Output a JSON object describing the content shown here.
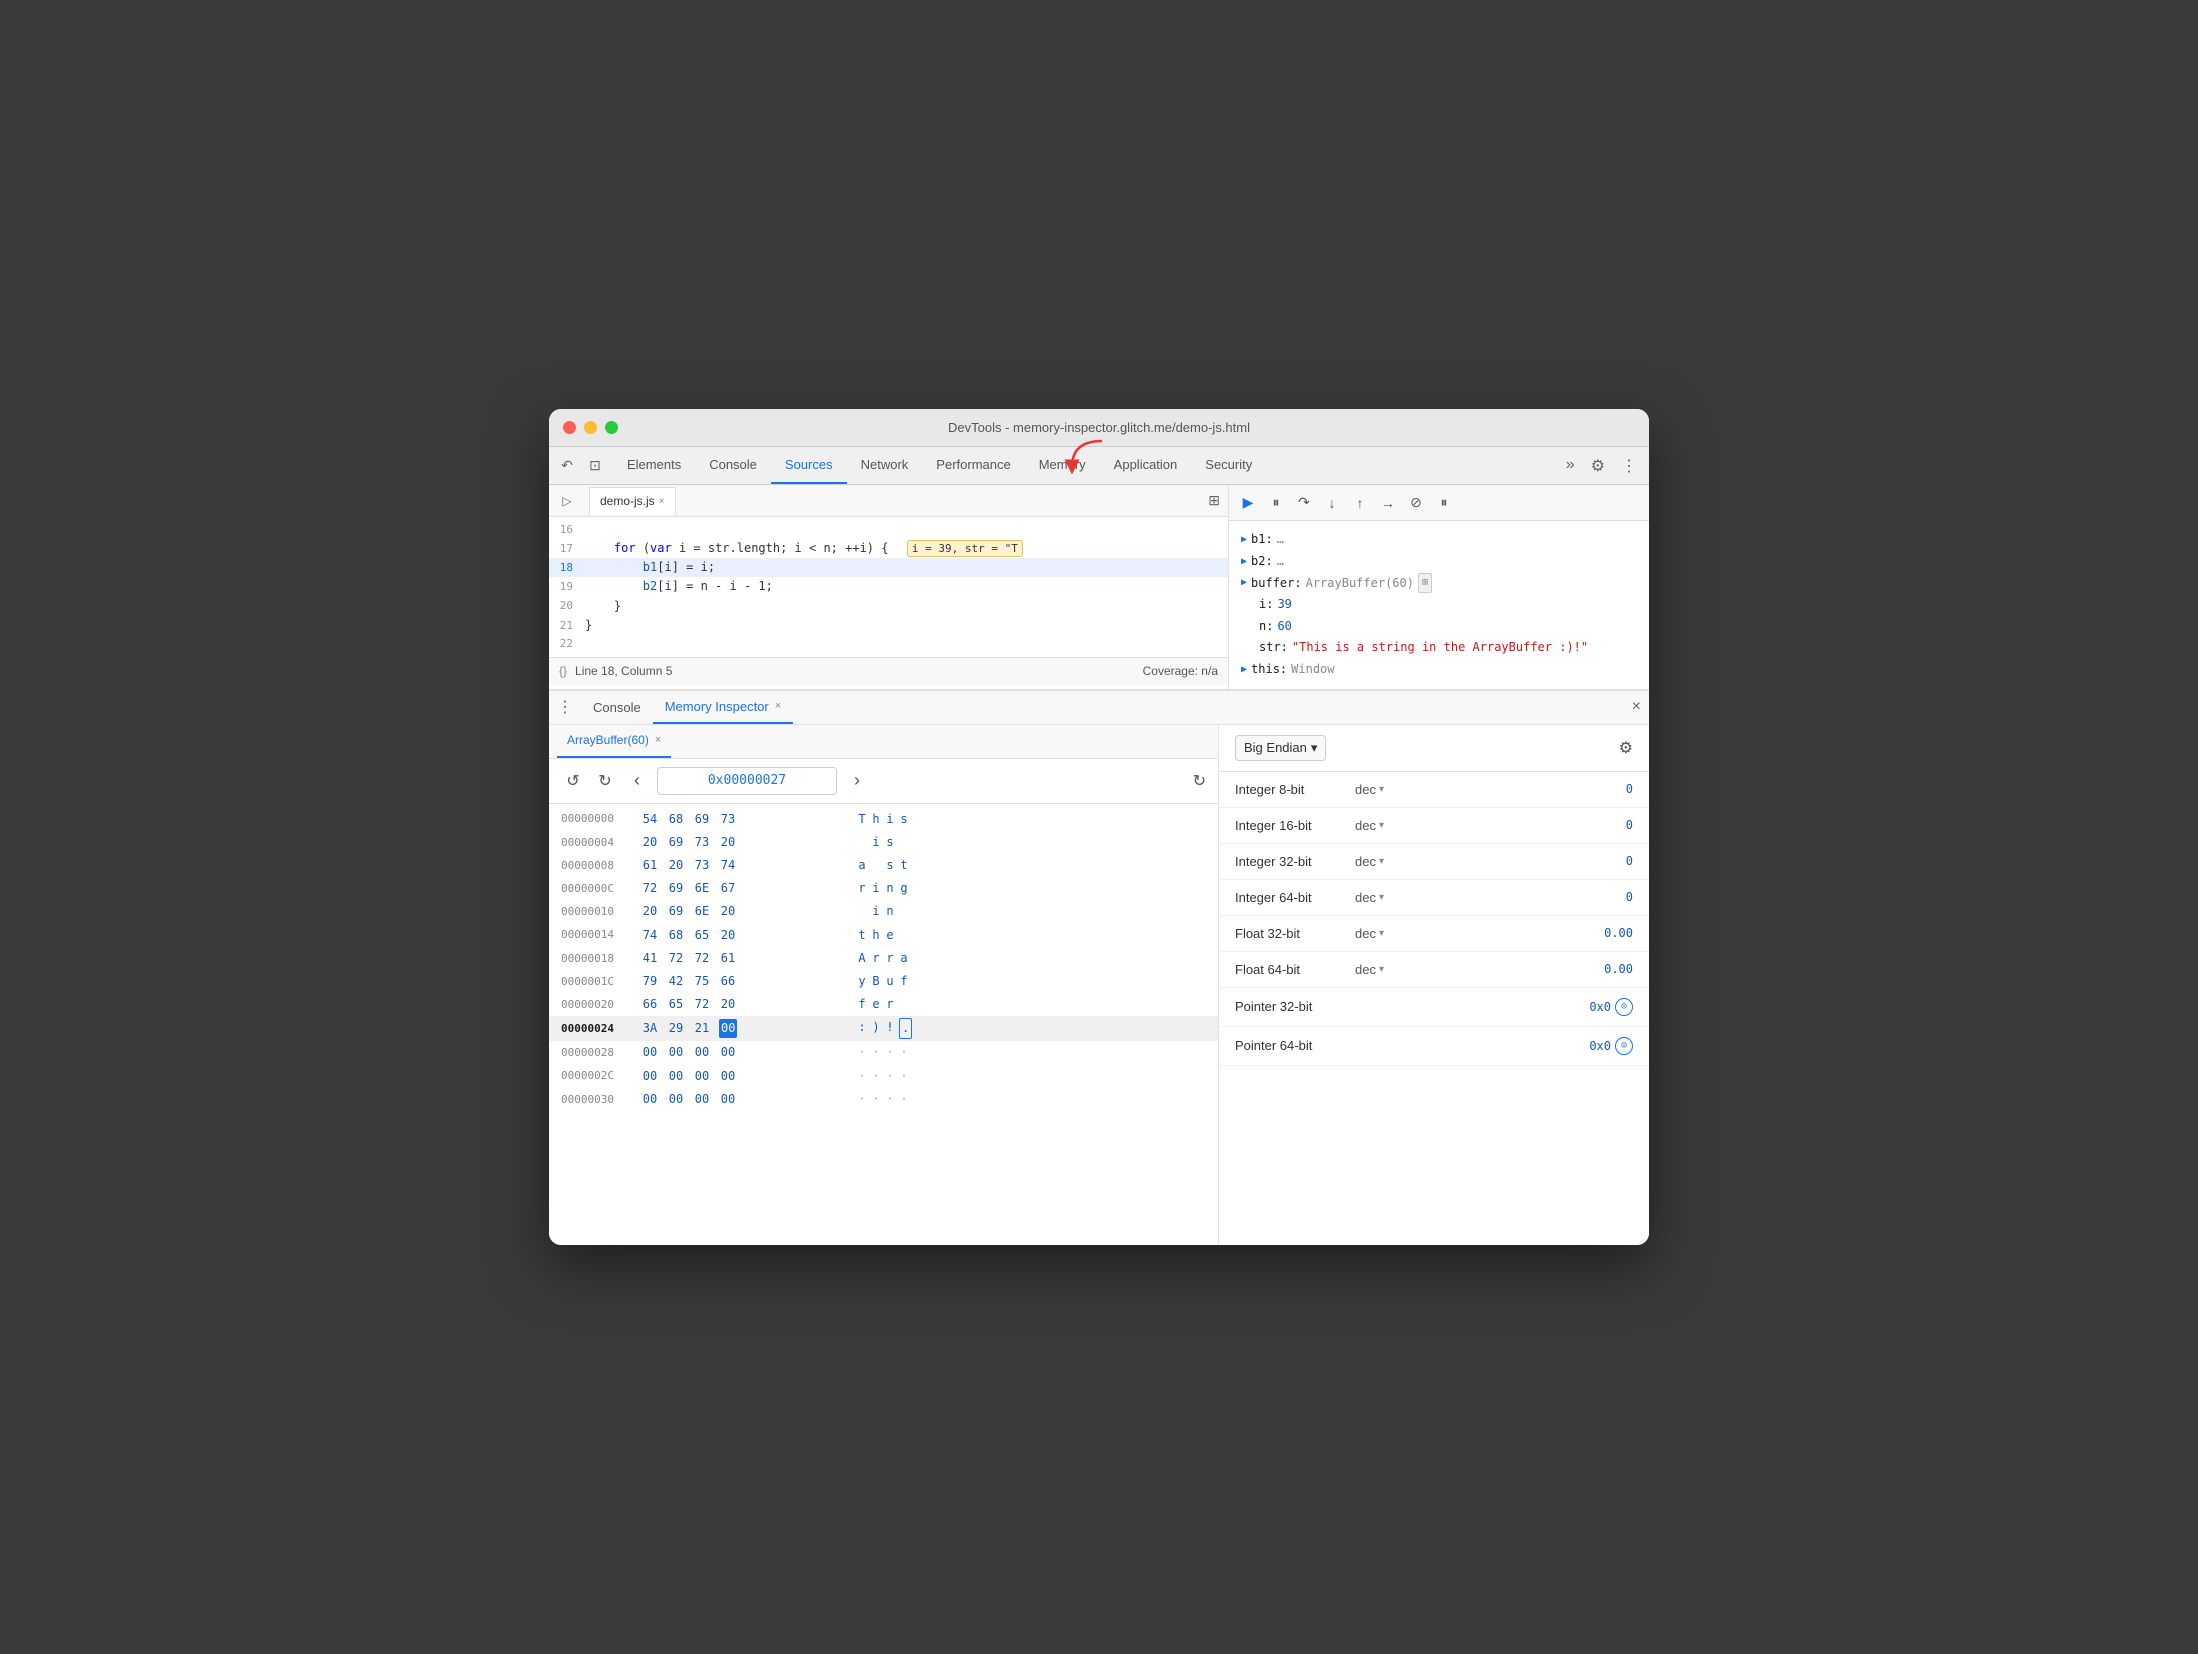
{
  "window": {
    "title": "DevTools - memory-inspector.glitch.me/demo-js.html"
  },
  "traffic_lights": {
    "red": "red",
    "yellow": "yellow",
    "green": "green"
  },
  "devtools_tabs": {
    "items": [
      {
        "label": "Elements",
        "active": false
      },
      {
        "label": "Console",
        "active": false
      },
      {
        "label": "Sources",
        "active": true
      },
      {
        "label": "Network",
        "active": false
      },
      {
        "label": "Performance",
        "active": false
      },
      {
        "label": "Memory",
        "active": false
      },
      {
        "label": "Application",
        "active": false
      },
      {
        "label": "Security",
        "active": false
      }
    ],
    "more_label": "»",
    "gear_icon": "⚙",
    "more_icon": "⋮"
  },
  "source_editor": {
    "tab_filename": "demo-js.js",
    "tab_close": "×",
    "status_line": "Line 18, Column 5",
    "status_coverage": "Coverage: n/a",
    "code_lines": [
      {
        "num": "16",
        "content": "",
        "highlighted": false
      },
      {
        "num": "17",
        "content": "    for (var i = str.length; i < n; ++i) {",
        "tooltip": "i = 39, str = \"T",
        "highlighted": false
      },
      {
        "num": "18",
        "content": "        b1[i] = i;",
        "highlighted": true
      },
      {
        "num": "19",
        "content": "        b2[i] = n - i - 1;",
        "highlighted": false
      },
      {
        "num": "20",
        "content": "    }",
        "highlighted": false
      },
      {
        "num": "21",
        "content": "}",
        "highlighted": false
      },
      {
        "num": "22",
        "content": "",
        "highlighted": false
      }
    ]
  },
  "debug_panel": {
    "vars": [
      {
        "key": "b1:",
        "val": "…",
        "type": "expand"
      },
      {
        "key": "b2:",
        "val": "…",
        "type": "expand"
      },
      {
        "key": "buffer:",
        "val": "ArrayBuffer(60)",
        "type": "expand",
        "icon": "⊞"
      },
      {
        "key": "i:",
        "val": "39",
        "type": "number"
      },
      {
        "key": "n:",
        "val": "60",
        "type": "number"
      },
      {
        "key": "str:",
        "val": "\"This is a string in the ArrayBuffer :)!\"",
        "type": "string"
      },
      {
        "key": "this:",
        "val": "Window",
        "type": "expand"
      }
    ]
  },
  "bottom_panel": {
    "tabs": [
      {
        "label": "Console",
        "active": false,
        "closeable": false
      },
      {
        "label": "Memory Inspector",
        "active": true,
        "closeable": true
      }
    ],
    "close_icon": "×"
  },
  "memory_inspector": {
    "arraybuffer_tab": "ArrayBuffer(60)",
    "tab_close": "×",
    "nav": {
      "back_icon": "↺",
      "forward_icon": "↻",
      "prev_icon": "‹",
      "address": "0x00000027",
      "next_icon": "›",
      "refresh_icon": "↻"
    },
    "hex_rows": [
      {
        "addr": "00000000",
        "bytes": [
          "54",
          "68",
          "69",
          "73"
        ],
        "chars": [
          "T",
          "h",
          "i",
          "s"
        ],
        "highlighted": false
      },
      {
        "addr": "00000004",
        "bytes": [
          "20",
          "69",
          "73",
          "20"
        ],
        "chars": [
          " ",
          "i",
          "s",
          " "
        ],
        "highlighted": false
      },
      {
        "addr": "00000008",
        "bytes": [
          "61",
          "20",
          "73",
          "74"
        ],
        "chars": [
          "a",
          " ",
          "s",
          "t"
        ],
        "highlighted": false
      },
      {
        "addr": "0000000C",
        "bytes": [
          "72",
          "69",
          "6E",
          "67"
        ],
        "chars": [
          "r",
          "i",
          "n",
          "g"
        ],
        "highlighted": false
      },
      {
        "addr": "00000010",
        "bytes": [
          "20",
          "69",
          "6E",
          "20"
        ],
        "chars": [
          " ",
          "i",
          "n",
          " "
        ],
        "highlighted": false
      },
      {
        "addr": "00000014",
        "bytes": [
          "74",
          "68",
          "65",
          "20"
        ],
        "chars": [
          "t",
          "h",
          "e",
          " "
        ],
        "highlighted": false
      },
      {
        "addr": "00000018",
        "bytes": [
          "41",
          "72",
          "72",
          "61"
        ],
        "chars": [
          "A",
          "r",
          "r",
          "a"
        ],
        "highlighted": false
      },
      {
        "addr": "0000001C",
        "bytes": [
          "79",
          "42",
          "75",
          "66"
        ],
        "chars": [
          "y",
          "B",
          "u",
          "f"
        ],
        "highlighted": false
      },
      {
        "addr": "00000020",
        "bytes": [
          "66",
          "65",
          "72",
          "20"
        ],
        "chars": [
          "f",
          "e",
          "r",
          " "
        ],
        "highlighted": false
      },
      {
        "addr": "00000024",
        "bytes": [
          "3A",
          "29",
          "21",
          "00"
        ],
        "chars": [
          ":",
          ")",
          " ",
          "·"
        ],
        "highlighted": true,
        "selected_byte": 3
      },
      {
        "addr": "00000028",
        "bytes": [
          "00",
          "00",
          "00",
          "00"
        ],
        "chars": [
          "·",
          "·",
          "·",
          "·"
        ],
        "highlighted": false
      },
      {
        "addr": "0000002C",
        "bytes": [
          "00",
          "00",
          "00",
          "00"
        ],
        "chars": [
          "·",
          "·",
          "·",
          "·"
        ],
        "highlighted": false
      },
      {
        "addr": "00000030",
        "bytes": [
          "00",
          "00",
          "00",
          "00"
        ],
        "chars": [
          "·",
          "·",
          "·",
          "·"
        ],
        "highlighted": false
      }
    ],
    "endian": {
      "label": "Big Endian",
      "dropdown_icon": "▾",
      "settings_icon": "⚙"
    },
    "type_rows": [
      {
        "label": "Integer 8-bit",
        "format": "dec",
        "value": "0",
        "type": "number"
      },
      {
        "label": "Integer 16-bit",
        "format": "dec",
        "value": "0",
        "type": "number"
      },
      {
        "label": "Integer 32-bit",
        "format": "dec",
        "value": "0",
        "type": "number"
      },
      {
        "label": "Integer 64-bit",
        "format": "dec",
        "value": "0",
        "type": "number"
      },
      {
        "label": "Float 32-bit",
        "format": "dec",
        "value": "0.00",
        "type": "number"
      },
      {
        "label": "Float 64-bit",
        "format": "dec",
        "value": "0.00",
        "type": "number"
      },
      {
        "label": "Pointer 32-bit",
        "format": "",
        "value": "0x0",
        "type": "pointer"
      },
      {
        "label": "Pointer 64-bit",
        "format": "",
        "value": "0x0",
        "type": "pointer"
      }
    ]
  }
}
